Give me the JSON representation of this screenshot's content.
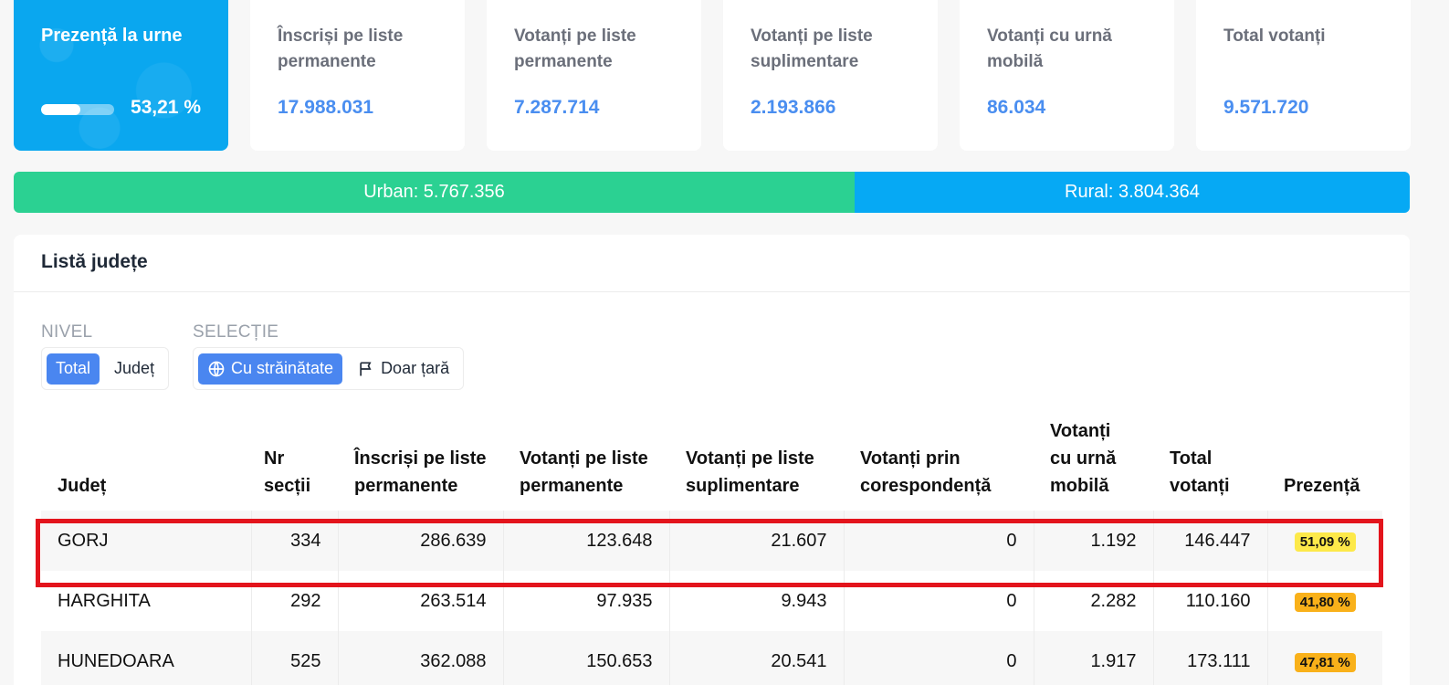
{
  "colors": {
    "accent": "#4a86f0",
    "urban": "#2bd192",
    "rural": "#06a9f4",
    "highlight": "#e3141c"
  },
  "presence": {
    "title": "Prezență la urne",
    "value": "53,21 %",
    "fill_fraction": 0.5321
  },
  "stats": [
    {
      "label": "Înscriși pe liste permanente",
      "value": "17.988.031"
    },
    {
      "label": "Votanți pe liste permanente",
      "value": "7.287.714"
    },
    {
      "label": "Votanți pe liste suplimentare",
      "value": "2.193.866"
    },
    {
      "label": "Votanți cu urnă mobilă",
      "value": "86.034"
    },
    {
      "label": "Total votanți",
      "value": "9.571.720"
    }
  ],
  "urban_rural": {
    "urban": "Urban: 5.767.356",
    "rural": "Rural: 3.804.364"
  },
  "panel": {
    "title": "Listă județe",
    "level": {
      "label": "NIVEL",
      "options": [
        "Total",
        "Județ"
      ],
      "selected": "Total"
    },
    "selection": {
      "label": "SELECȚIE",
      "options": [
        "Cu străinătate",
        "Doar țară"
      ],
      "selected": "Cu străinătate",
      "icons": [
        "globe-icon",
        "flag-icon"
      ]
    }
  },
  "table": {
    "headers": [
      "Județ",
      "Nr secții",
      "Înscriși pe liste permanente",
      "Votanți pe liste permanente",
      "Votanți pe liste suplimentare",
      "Votanți prin corespondență",
      "Votanți cu urnă mobilă",
      "Total votanți",
      "Prezență"
    ],
    "rows": [
      {
        "cells": [
          "GORJ",
          "334",
          "286.639",
          "123.648",
          "21.607",
          "0",
          "1.192",
          "146.447",
          "51,09 %"
        ],
        "badge_color": "#fde94a"
      },
      {
        "cells": [
          "HARGHITA",
          "292",
          "263.514",
          "97.935",
          "9.943",
          "0",
          "2.282",
          "110.160",
          "41,80 %"
        ],
        "badge_color": "#f9b11a"
      },
      {
        "cells": [
          "HUNEDOARA",
          "525",
          "362.088",
          "150.653",
          "20.541",
          "0",
          "1.917",
          "173.111",
          "47,81 %"
        ],
        "badge_color": "#f9b11a"
      }
    ]
  }
}
